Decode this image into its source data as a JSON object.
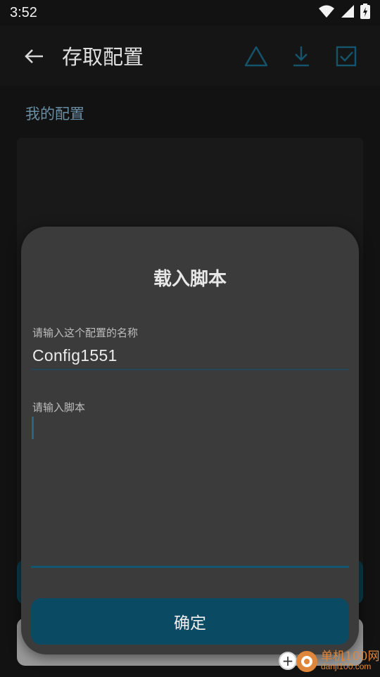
{
  "status_bar": {
    "time": "3:52",
    "icons": [
      "wifi-icon",
      "signal-icon",
      "battery-charging-icon"
    ]
  },
  "app_bar": {
    "title": "存取配置",
    "actions": [
      "warning-icon",
      "download-icon",
      "checkbox-icon"
    ]
  },
  "section": {
    "label": "我的配置"
  },
  "dialog": {
    "title": "载入脚本",
    "name_field": {
      "label": "请输入这个配置的名称",
      "value": "Config1551"
    },
    "script_field": {
      "label": "请输入脚本",
      "value": ""
    },
    "confirm_label": "确定"
  },
  "watermark": {
    "line1": "单机100网",
    "line2": "danji100.com"
  },
  "colors": {
    "accent": "#0b4a63",
    "dialog_bg": "#3b3b3b",
    "background": "#121212",
    "section_label": "#6a8ea3",
    "watermark": "#e0863a"
  }
}
